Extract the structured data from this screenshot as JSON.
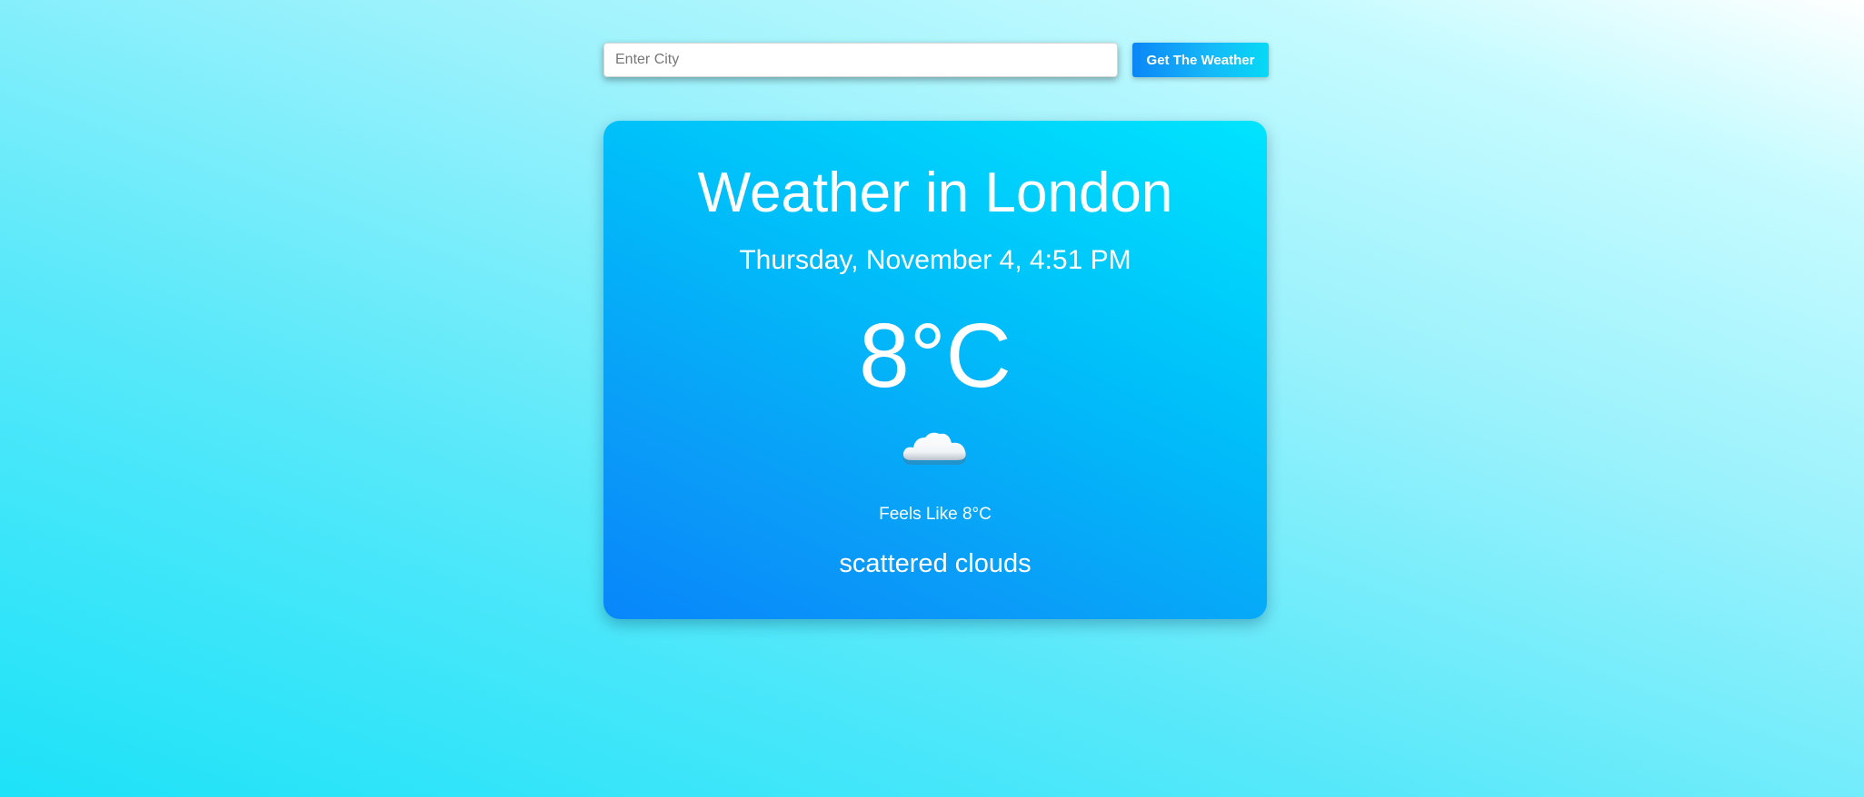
{
  "search": {
    "placeholder": "Enter City",
    "value": "",
    "button_label": "Get The Weather"
  },
  "weather": {
    "title": "Weather in London",
    "datetime": "Thursday, November 4, 4:51 PM",
    "temperature": "8°C",
    "icon": "cloud-icon",
    "feels_like": "Feels Like 8°C",
    "description": "scattered clouds"
  },
  "colors": {
    "accent": "#0a86f7",
    "card_top": "#00e4fe",
    "card_bottom": "#0886fa",
    "text": "#ffffff"
  }
}
